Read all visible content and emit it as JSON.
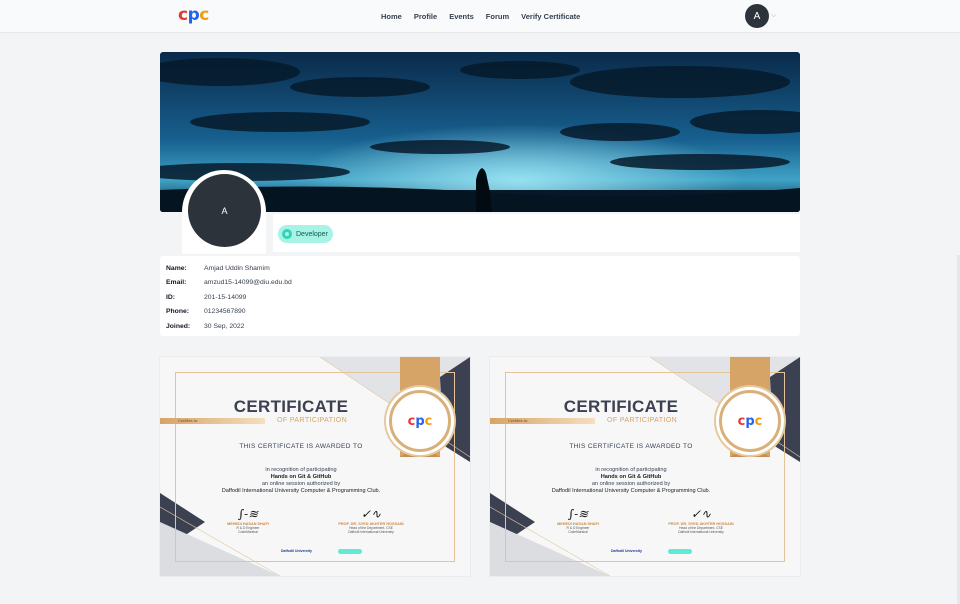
{
  "nav": {
    "logo_letters": [
      "c",
      "p",
      "c"
    ],
    "logo_colors": [
      "#e53935",
      "#2563eb",
      "#f59e0b"
    ],
    "links": [
      "Home",
      "Profile",
      "Events",
      "Forum",
      "Verify Certificate"
    ],
    "avatar_letter": "A",
    "caret_icon": "chevron-down-icon"
  },
  "profile": {
    "avatar_letter": "A",
    "role": "Developer",
    "role_icon": "developer-icon",
    "fields": [
      {
        "label": "Name:",
        "value": "Amjad Uddin Shamim"
      },
      {
        "label": "Email:",
        "value": "amzud15-14099@diu.edu.bd"
      },
      {
        "label": "ID:",
        "value": "201-15-14099"
      },
      {
        "label": "Phone:",
        "value": "01234567890"
      },
      {
        "label": "Joined:",
        "value": "30 Sep, 2022"
      }
    ]
  },
  "certificates": [
    {
      "title": "CERTIFICATE",
      "subtitle": "OF PARTICIPATION",
      "certify": "Certifies to:",
      "awarded": "THIS CERTIFICATE IS AWARDED TO",
      "line1": "in recognition of participating",
      "event": "Hands on Git & GitHub",
      "line3": "an online session authorized by",
      "org": "Daffodil International University Computer & Programming Club.",
      "signer1_name": "MEHEDI HASAN SHAFI",
      "signer1_role1": "R & D Engineer",
      "signer1_role2": "CodeMarshal",
      "signer2_name": "PROF. DR. SYED AKHTER HOSSAIN",
      "signer2_role1": "Head of the Department, CSE",
      "signer2_role2": "Daffodil International University",
      "footer_logo": "Daffodil University"
    },
    {
      "title": "CERTIFICATE",
      "subtitle": "OF PARTICIPATION",
      "certify": "Certifies to:",
      "awarded": "THIS CERTIFICATE IS AWARDED TO",
      "line1": "in recognition of participating",
      "event": "Hands on Git & GitHub",
      "line3": "an online session authorized by",
      "org": "Daffodil International University Computer & Programming Club.",
      "signer1_name": "MEHEDI HASAN SHAFI",
      "signer1_role1": "R & D Engineer",
      "signer1_role2": "CodeMarshal",
      "signer2_name": "PROF. DR. SYED AKHTER HOSSAIN",
      "signer2_role1": "Head of the Department, CSE",
      "signer2_role2": "Daffodil International University",
      "footer_logo": "Daffodil University"
    }
  ],
  "colors": {
    "accent_teal": "#a7f3e6",
    "avatar_dark": "#2d333b",
    "cert_gold": "#d9a466",
    "cert_navy": "#3b4150"
  }
}
